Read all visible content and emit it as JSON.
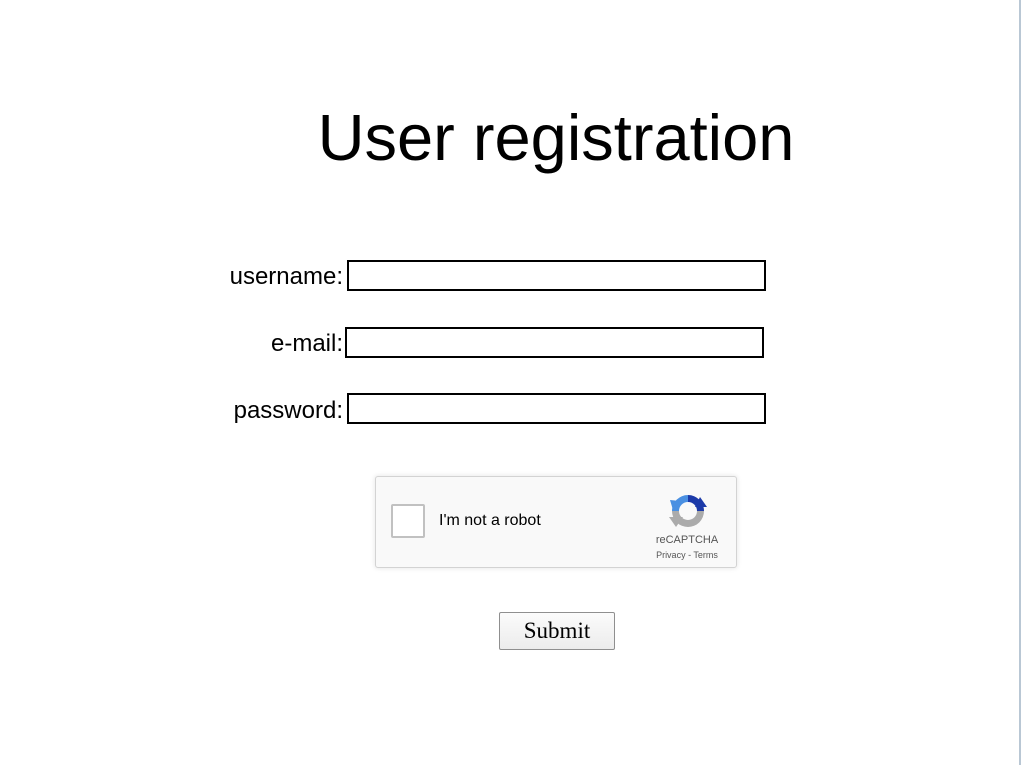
{
  "page": {
    "title": "User registration"
  },
  "form": {
    "username_label": "username:",
    "username_value": "",
    "email_label": "e-mail:",
    "email_value": "",
    "password_label": "password:",
    "password_value": "",
    "submit_label": "Submit"
  },
  "recaptcha": {
    "checkbox_checked": false,
    "label": "I'm not a robot",
    "brand": "reCAPTCHA",
    "privacy_link": "Privacy",
    "separator": " - ",
    "terms_link": "Terms",
    "logo_icon": "recaptcha-logo-icon",
    "colors": {
      "blue": "#1c3aa9",
      "light_blue": "#4a90e2",
      "gray": "#ababab"
    }
  }
}
